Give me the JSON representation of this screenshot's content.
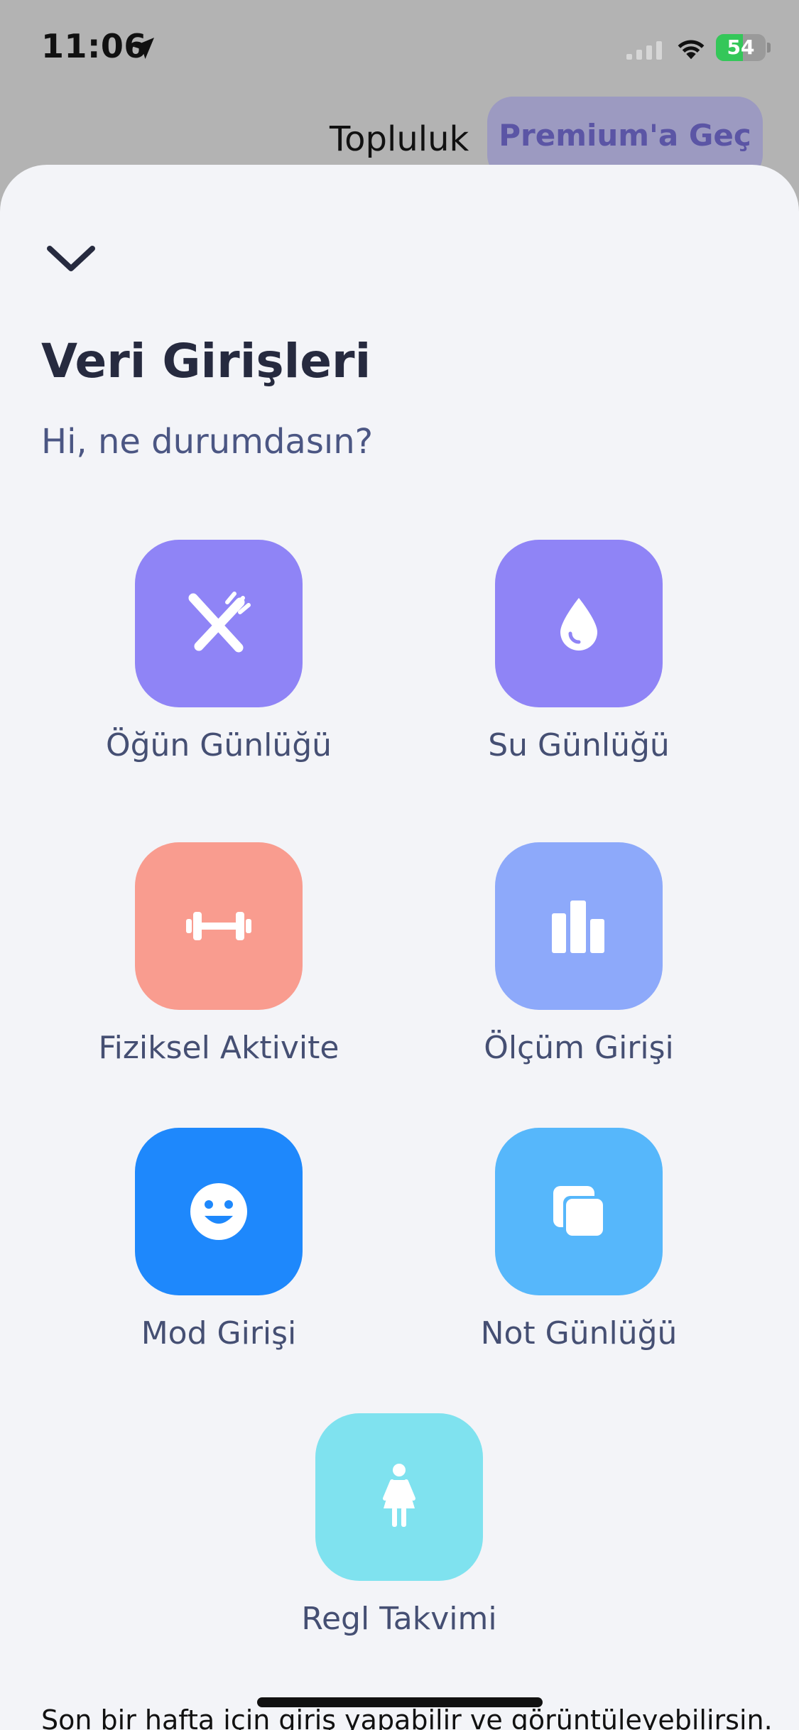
{
  "status_bar": {
    "time": "11:06",
    "battery_level": "54",
    "battery_fraction": 0.54
  },
  "header": {
    "community_label": "Topluluk",
    "premium_label": "Premium'a Geç"
  },
  "sheet": {
    "title": "Veri Girişleri",
    "subtitle": "Hi, ne durumdasın?",
    "tiles": [
      {
        "label": "Öğün Günlüğü",
        "icon": "utensils-icon",
        "color": "#8f84f6"
      },
      {
        "label": "Su Günlüğü",
        "icon": "water-drop-icon",
        "color": "#8f84f6"
      },
      {
        "label": "Fiziksel Aktivite",
        "icon": "dumbbell-icon",
        "color": "#f99c8f"
      },
      {
        "label": "Ölçüm Girişi",
        "icon": "bar-chart-icon",
        "color": "#8da9fa"
      },
      {
        "label": "Mod Girişi",
        "icon": "smiley-icon",
        "color": "#1e88fc"
      },
      {
        "label": "Not Günlüğü",
        "icon": "notes-icon",
        "color": "#56b7fb"
      },
      {
        "label": "Regl Takvimi",
        "icon": "woman-icon",
        "color": "#7fe2ef"
      }
    ],
    "footer_text": "Son bir hafta için giriş yapabilir ve görüntüleyebilirsin."
  }
}
